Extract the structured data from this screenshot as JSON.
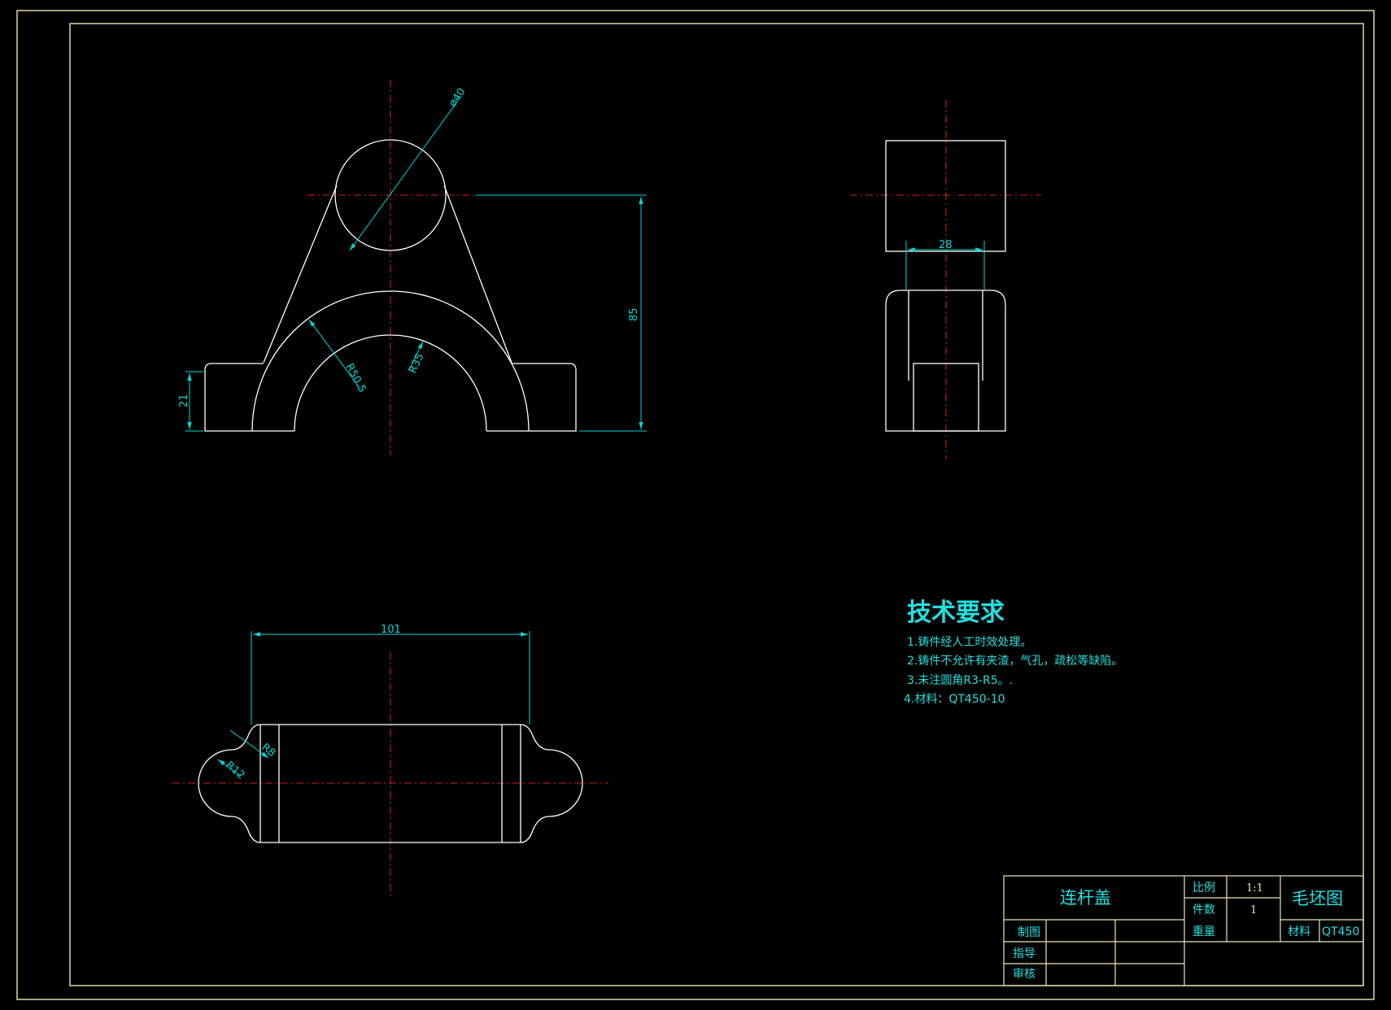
{
  "dimensions": {
    "top_diameter": "ø40",
    "outer_radius": "R50.5",
    "inner_radius": "R35",
    "height": "85",
    "flange_height": "21",
    "side_width": "28",
    "bottom_length": "101",
    "bottom_radius_large": "R12",
    "bottom_radius_small": "R8"
  },
  "technical_requirements": {
    "title": "技术要求",
    "items": [
      "1.铸件经人工时效处理。",
      "2.铸件不允许有夹渣，气孔，疏松等缺陷。",
      "3.未注圆角R3-R5。.",
      "4.材料：QT450-10"
    ]
  },
  "title_block": {
    "part_name": "连杆盖",
    "scale_label": "比例",
    "scale_value": "1:1",
    "quantity_label": "件数",
    "quantity_value": "1",
    "weight_label": "重量",
    "drawing_type": "毛坯图",
    "material_label": "材料",
    "material_value": "QT450",
    "drawn_by_label": "制图",
    "guided_by_label": "指导",
    "reviewed_by_label": "审核"
  }
}
